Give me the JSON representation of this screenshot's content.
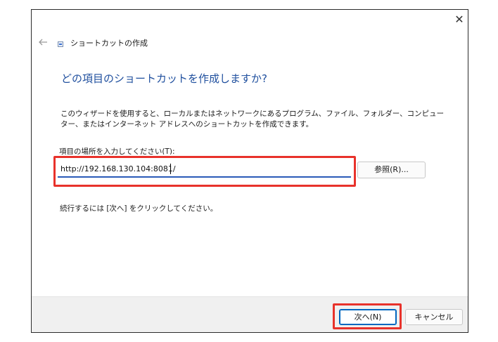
{
  "window": {
    "close_glyph": "✕",
    "back_glyph": "←",
    "title": "ショートカットの作成"
  },
  "main": {
    "heading": "どの項目のショートカットを作成しますか?",
    "description": "このウィザードを使用すると、ローカルまたはネットワークにあるプログラム、ファイル、フォルダー、コンピューター、またはインターネット アドレスへのショートカットを作成できます。",
    "field_label": "項目の場所を入力してください(T):",
    "location_value": "http://192.168.130.104:8081/",
    "browse_label": "参照(R)...",
    "hint": "続行するには [次へ] をクリックしてください。"
  },
  "footer": {
    "next_label": "次へ(N)",
    "cancel_label": "キャンセル"
  },
  "colors": {
    "heading": "#1f4f9e",
    "highlight": "#e8322b",
    "focus": "#2a5ab8"
  },
  "icons": {
    "close": "close-icon",
    "back": "back-arrow-icon",
    "wizard": "shortcut-wizard-icon"
  }
}
